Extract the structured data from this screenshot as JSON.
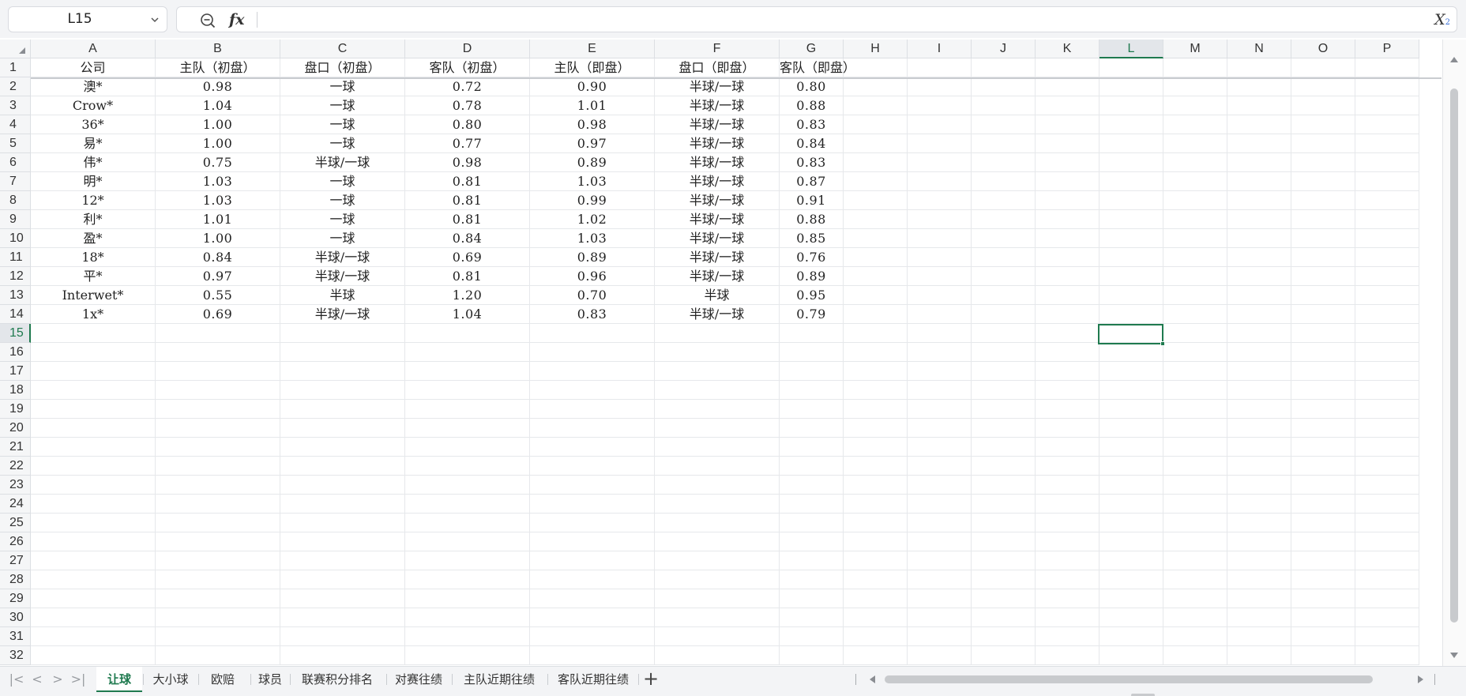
{
  "formula_bar": {
    "name_box": "L15",
    "formula_value": ""
  },
  "icons": {
    "zoom": "zoom-out-icon",
    "fx": "fx",
    "name_box_dropdown": "chevron-down-icon",
    "subscript": "X",
    "subscript_small": "2"
  },
  "colors": {
    "accent": "#1f7a4f",
    "grid_line": "#e6e8eb",
    "header_bg": "#f5f6f7"
  },
  "columns": [
    "A",
    "B",
    "C",
    "D",
    "E",
    "F",
    "G",
    "H",
    "I",
    "J",
    "K",
    "L",
    "M",
    "N",
    "O",
    "P"
  ],
  "selected": {
    "column": "L",
    "row": 15
  },
  "row_count": 32,
  "header_row": [
    "公司",
    "主队（初盘）",
    "盘口（初盘）",
    "客队（初盘）",
    "主队（即盘）",
    "盘口（即盘）",
    "客队（即盘）"
  ],
  "rows": [
    [
      "澳*",
      "0.98",
      "一球",
      "0.72",
      "0.90",
      "半球/一球",
      "0.80"
    ],
    [
      "Crow*",
      "1.04",
      "一球",
      "0.78",
      "1.01",
      "半球/一球",
      "0.88"
    ],
    [
      "36*",
      "1.00",
      "一球",
      "0.80",
      "0.98",
      "半球/一球",
      "0.83"
    ],
    [
      "易*",
      "1.00",
      "一球",
      "0.77",
      "0.97",
      "半球/一球",
      "0.84"
    ],
    [
      "伟*",
      "0.75",
      "半球/一球",
      "0.98",
      "0.89",
      "半球/一球",
      "0.83"
    ],
    [
      "明*",
      "1.03",
      "一球",
      "0.81",
      "1.03",
      "半球/一球",
      "0.87"
    ],
    [
      "12*",
      "1.03",
      "一球",
      "0.81",
      "0.99",
      "半球/一球",
      "0.91"
    ],
    [
      "利*",
      "1.01",
      "一球",
      "0.81",
      "1.02",
      "半球/一球",
      "0.88"
    ],
    [
      "盈*",
      "1.00",
      "一球",
      "0.84",
      "1.03",
      "半球/一球",
      "0.85"
    ],
    [
      "18*",
      "0.84",
      "半球/一球",
      "0.69",
      "0.89",
      "半球/一球",
      "0.76"
    ],
    [
      "平*",
      "0.97",
      "半球/一球",
      "0.81",
      "0.96",
      "半球/一球",
      "0.89"
    ],
    [
      "Interwet*",
      "0.55",
      "半球",
      "1.20",
      "0.70",
      "半球",
      "0.95"
    ],
    [
      "1x*",
      "0.69",
      "半球/一球",
      "1.04",
      "0.83",
      "半球/一球",
      "0.79"
    ]
  ],
  "sheet_nav": [
    "|<",
    "<",
    ">",
    ">|"
  ],
  "sheet_tabs": [
    "让球",
    "大小球",
    "欧赔",
    "球员",
    "联赛积分排名",
    "对赛往绩",
    "主队近期往绩",
    "客队近期往绩"
  ],
  "active_tab_index": 0,
  "add_sheet": "+"
}
